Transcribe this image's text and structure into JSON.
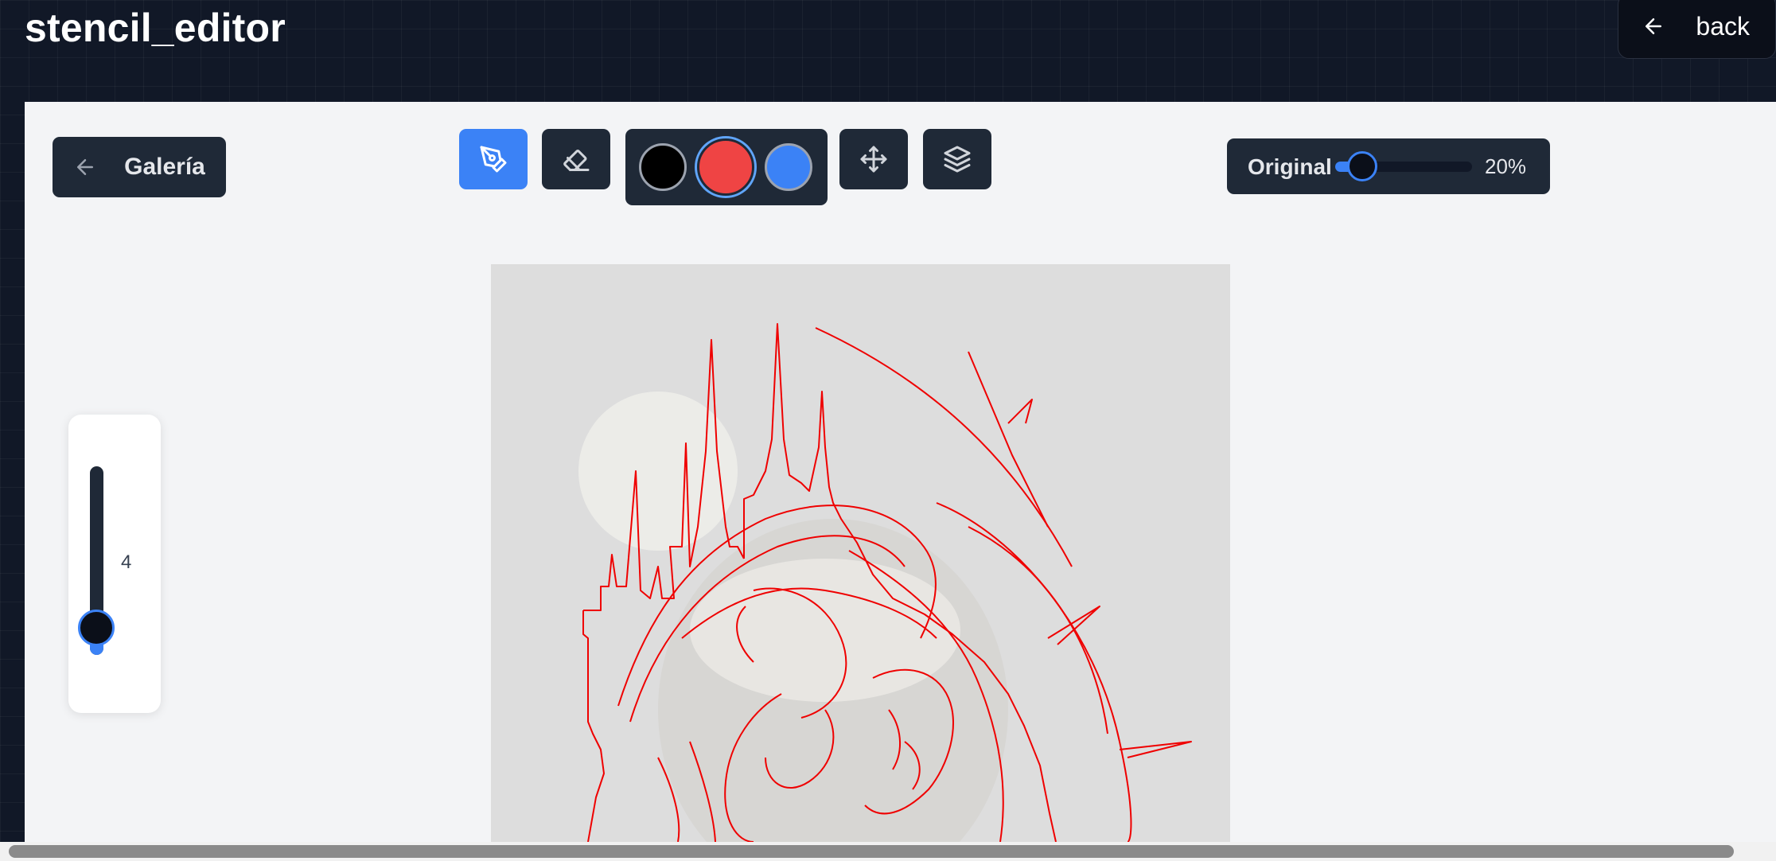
{
  "app": {
    "title": "stencil_editor"
  },
  "header": {
    "back_label": "back",
    "back_icon": "arrow-left-icon"
  },
  "toolbar": {
    "gallery_label": "Galería",
    "gallery_icon": "arrow-left-icon",
    "tools": [
      {
        "name": "pen",
        "icon": "pen-tool-icon",
        "active": true
      },
      {
        "name": "eraser",
        "icon": "eraser-icon",
        "active": false
      },
      {
        "name": "move",
        "icon": "move-icon",
        "active": false
      },
      {
        "name": "layers",
        "icon": "layers-icon",
        "active": false
      }
    ],
    "colors": [
      {
        "name": "black",
        "hex": "#000000",
        "selected": false
      },
      {
        "name": "red",
        "hex": "#ef4444",
        "selected": true
      },
      {
        "name": "blue",
        "hex": "#3b82f6",
        "selected": false
      }
    ]
  },
  "opacity": {
    "label": "Original",
    "value_text": "20%",
    "value": 0.2
  },
  "brush": {
    "size_text": "4",
    "size_fraction": 0.1
  },
  "canvas": {
    "stroke_color": "#ef0000",
    "background": "#dddddd"
  },
  "colors": {
    "accent": "#3b82f6",
    "panel": "#1f2937",
    "page_bg": "#111827",
    "workspace_bg": "#f3f4f6"
  }
}
